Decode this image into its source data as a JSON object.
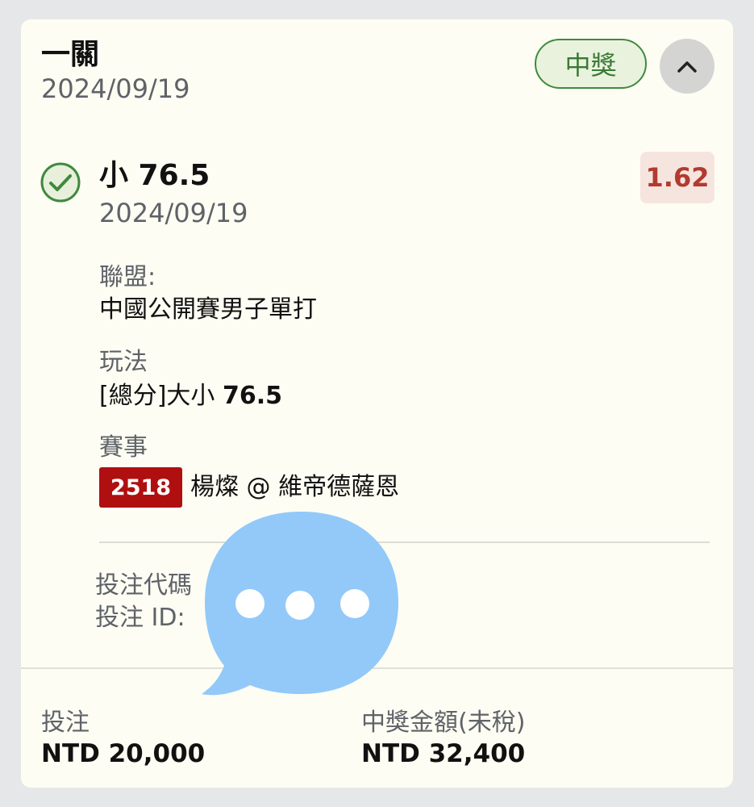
{
  "header": {
    "title": "一關",
    "date": "2024/09/19",
    "status_label": "中獎"
  },
  "selection": {
    "title": "小 76.5",
    "date": "2024/09/19",
    "odds": "1.62"
  },
  "details": {
    "league_label": "聯盟:",
    "league_value": "中國公開賽男子單打",
    "play_label": "玩法",
    "play_prefix": "[總分]大小 ",
    "play_value": "76.5",
    "event_label": "賽事",
    "event_number": "2518",
    "event_value": "楊燦 @ 維帝德薩恩"
  },
  "codes": {
    "bet_code_label": "投注代碼",
    "bet_id_label": "投注 ID:"
  },
  "footer": {
    "stake_label": "投注",
    "stake_value": "NTD 20,000",
    "payout_label": "中獎金額(未稅)",
    "payout_value": "NTD 32,400"
  },
  "colors": {
    "win_green": "#3f8a3e",
    "odds_red": "#b23a2f",
    "event_badge_red": "#b00f10",
    "chat_overlay_blue": "#92c9f9"
  },
  "icons": {
    "check": "check-circle-icon",
    "collapse": "chevron-up-icon",
    "overlay": "chat-bubble-icon"
  }
}
